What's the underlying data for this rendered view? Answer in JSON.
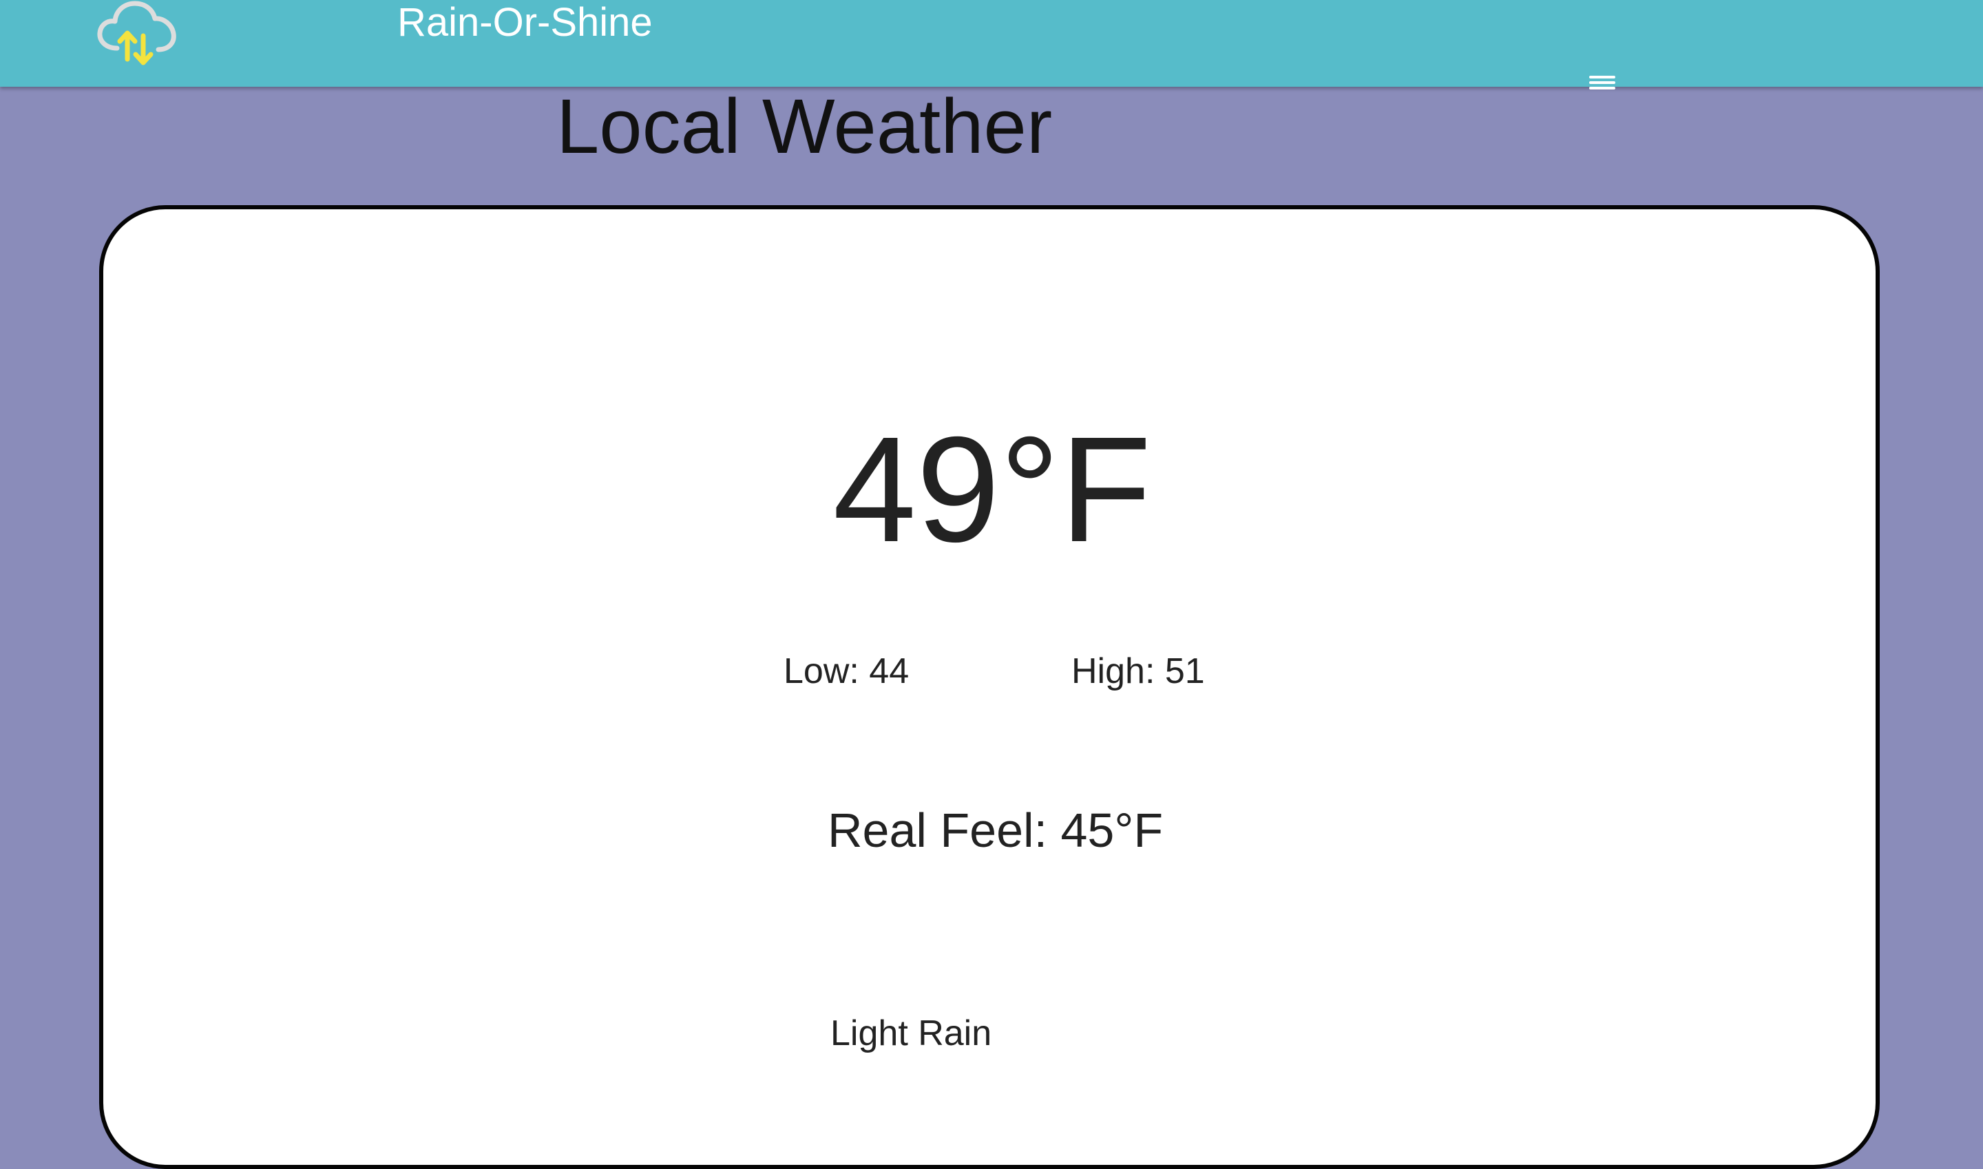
{
  "header": {
    "logo_icon": "cloud-upload-download-icon",
    "brand_name": "Rain-Or-Shine",
    "menu_icon": "hamburger-menu-icon"
  },
  "page": {
    "title": "Local Weather"
  },
  "weather": {
    "temperature": "49°F",
    "low": "Low: 44",
    "high": "High: 51",
    "real_feel": "Real Feel: 45°F",
    "condition": "Light Rain"
  },
  "colors": {
    "header_background": "#56bcca",
    "page_background": "#8a8cba",
    "card_background": "#ffffff",
    "logo_cloud": "#dddddd",
    "logo_arrows": "#f4e33f"
  }
}
